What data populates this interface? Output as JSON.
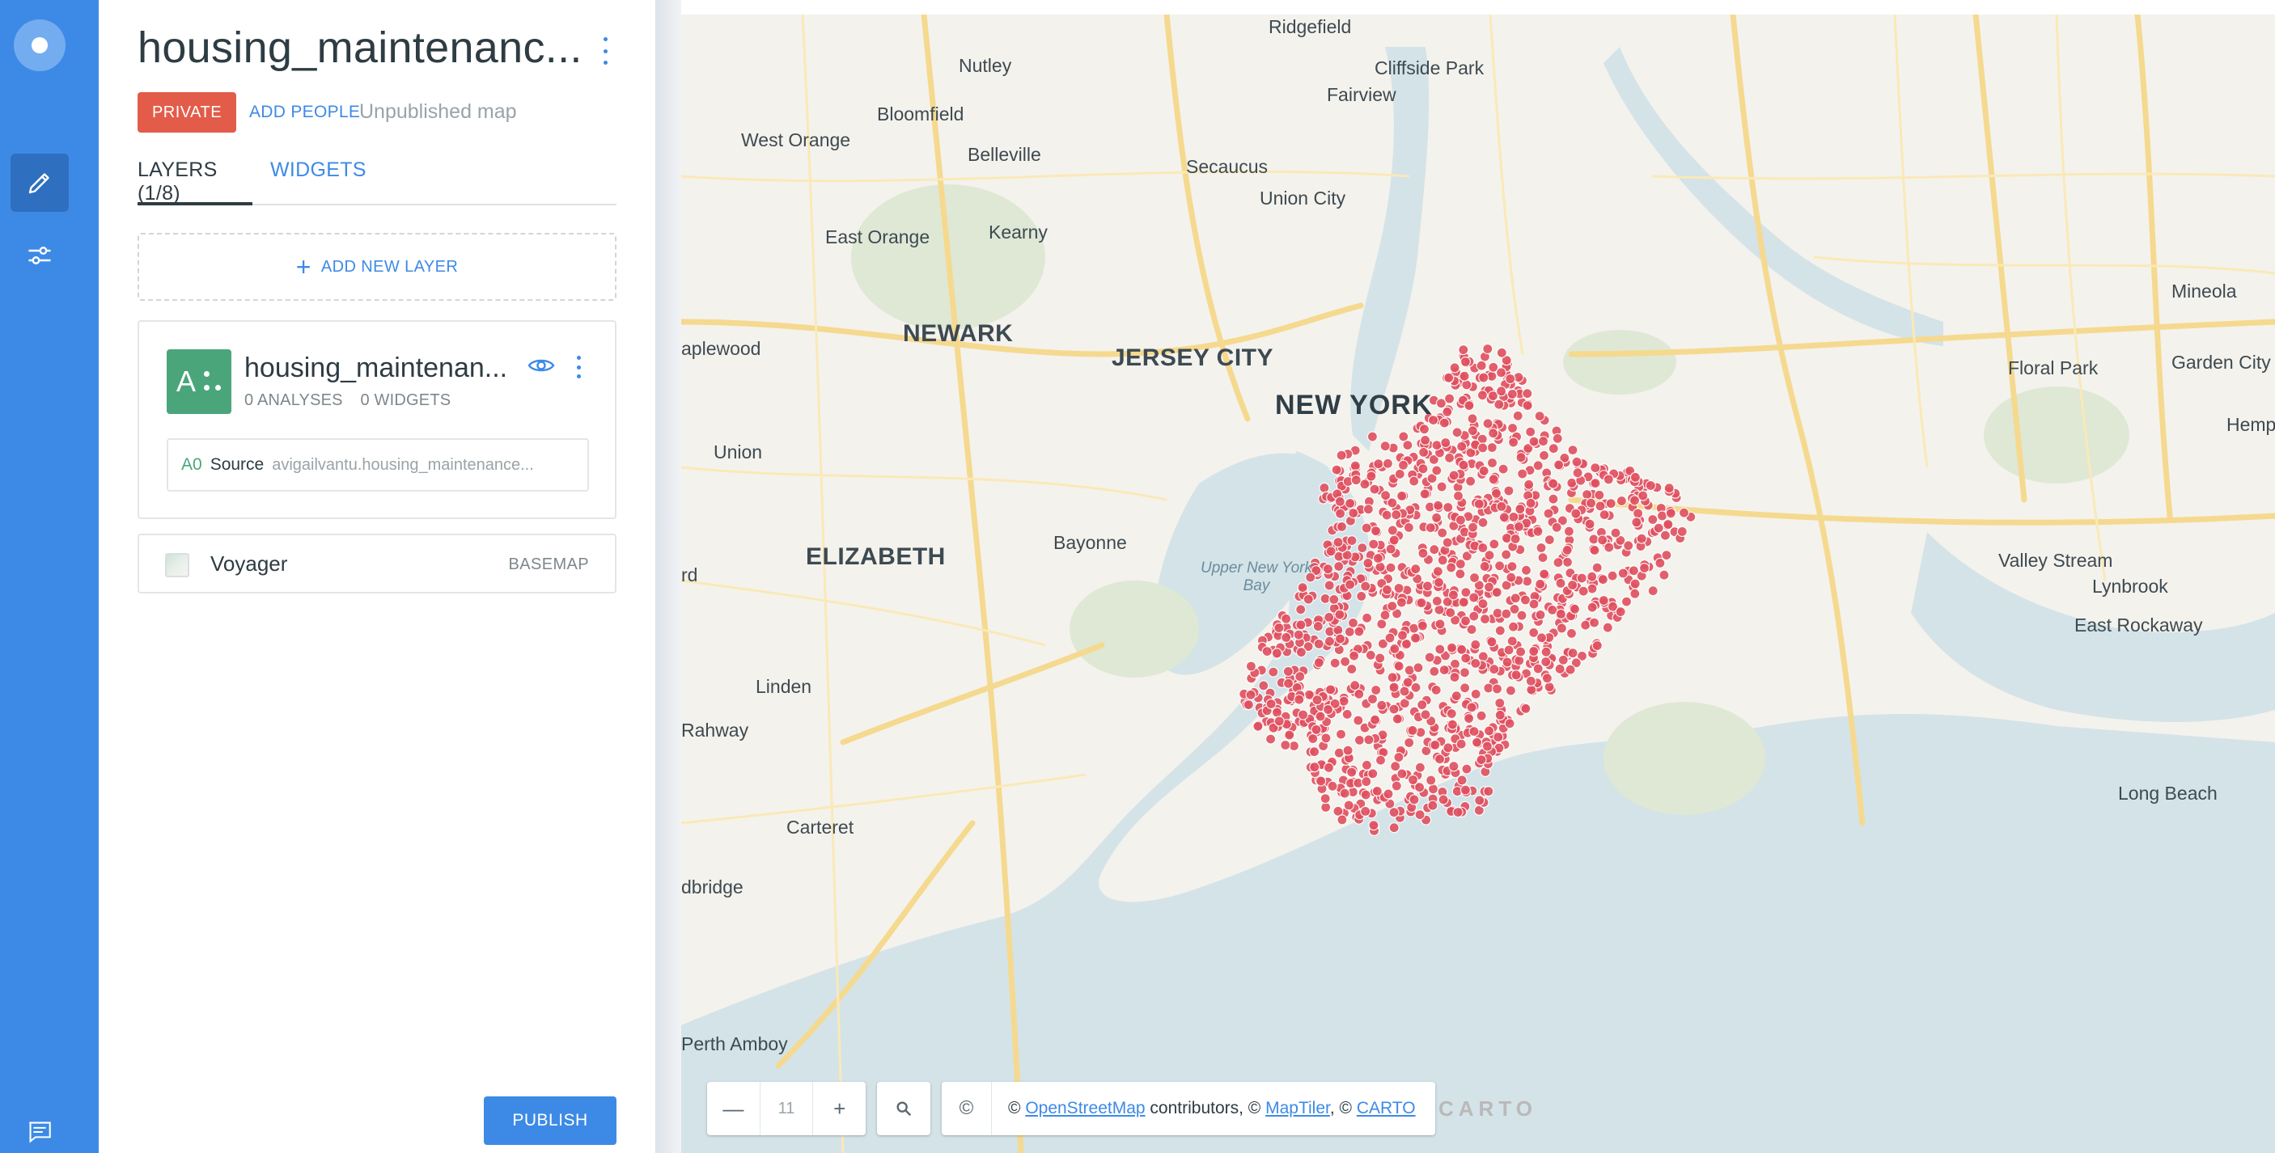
{
  "nav": {
    "items": [
      "logo",
      "edit",
      "settings"
    ]
  },
  "header": {
    "title": "housing_maintenanc...",
    "privacy_badge": "PRIVATE",
    "add_people": "ADD PEOPLE",
    "status": "Unpublished map"
  },
  "tabs": [
    {
      "label": "LAYERS (1/8)",
      "active": true
    },
    {
      "label": "WIDGETS",
      "active": false
    }
  ],
  "add_layer_label": "ADD NEW LAYER",
  "layer": {
    "icon_letter": "A",
    "name": "housing_maintenan...",
    "analyses": "0 ANALYSES",
    "widgets": "0 WIDGETS",
    "source_id": "A0",
    "source_label": "Source",
    "source_path": "avigailvantu.housing_maintenance...",
    "color": "#4aa57b"
  },
  "basemap": {
    "name": "Voyager",
    "tag": "BASEMAP"
  },
  "publish_label": "PUBLISH",
  "map": {
    "zoom": "11",
    "zoom_out": "—",
    "zoom_in": "+",
    "attribution": {
      "copyright": "©",
      "prefix": "© ",
      "osm": "OpenStreetMap",
      "mid": " contributors, © ",
      "maptiler": "MapTiler",
      "sep": ", © ",
      "carto": "CARTO"
    },
    "logo": "CARTO",
    "point_color": "#e0505f",
    "labels": {
      "ridgefield": "Ridgefield",
      "nutley": "Nutley",
      "cliffside": "Cliffside Park",
      "fairview": "Fairview",
      "bloomfield": "Bloomfield",
      "west_orange": "West Orange",
      "belleville": "Belleville",
      "secaucus": "Secaucus",
      "union_city": "Union City",
      "east_orange": "East Orange",
      "kearny": "Kearny",
      "mineola": "Mineola",
      "newark": "NEWARK",
      "jersey_city": "JERSEY CITY",
      "maplewood": "aplewood",
      "floral_park": "Floral Park",
      "garden_city": "Garden City",
      "new_york": "NEW YORK",
      "hempstead": "Hempst",
      "union": "Union",
      "bayonne": "Bayonne",
      "elizabeth": "ELIZABETH",
      "upper_bay_1": "Upper New York",
      "upper_bay_2": "Bay",
      "valley_stream": "Valley Stream",
      "lynbrook": "Lynbrook",
      "rd": "rd",
      "east_rockaway": "East Rockaway",
      "linden": "Linden",
      "rahway": "Rahway",
      "carteret": "Carteret",
      "long_beach": "Long Beach",
      "woodbridge": "dbridge",
      "perth_amboy": "Perth Amboy"
    }
  }
}
